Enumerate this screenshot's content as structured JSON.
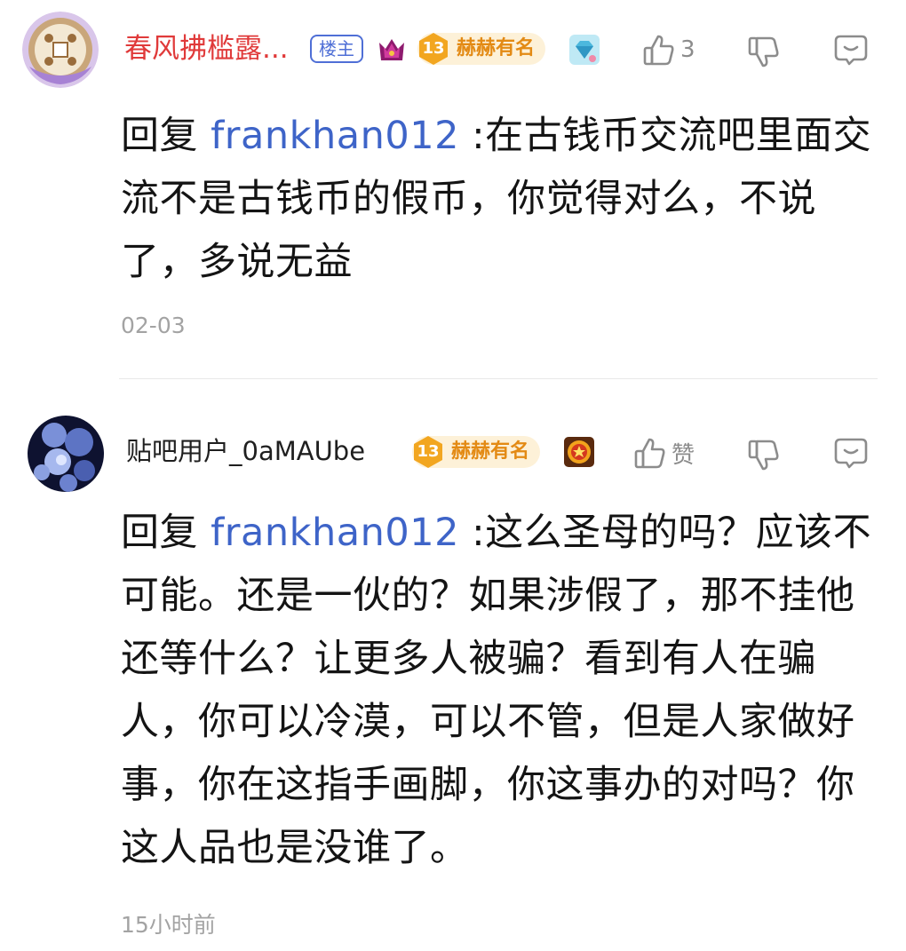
{
  "comments": [
    {
      "username": "春风拂槛露...",
      "op_badge": "楼主",
      "level": "13",
      "level_title": "赫赫有名",
      "like_label": "3",
      "reply_prefix": "回复",
      "mention": "frankhan012",
      "text": ":在古钱币交流吧里面交流不是古钱币的假币，你觉得对么，不说了，多说无益",
      "time": "02-03",
      "icons": [
        "avatar",
        "crown-badge-icon",
        "level-badge-icon",
        "diamond-badge-icon",
        "thumbs-up-icon",
        "thumbs-down-icon",
        "reply-icon"
      ]
    },
    {
      "username": "贴吧用户_0aMAUbe",
      "level": "13",
      "level_title": "赫赫有名",
      "like_label": "赞",
      "reply_prefix": "回复",
      "mention": "frankhan012",
      "text": ":这么圣母的吗？应该不可能。还是一伙的？如果涉假了，那不挂他还等什么？让更多人被骗？看到有人在骗人，你可以冷漠，可以不管，但是人家做好事，你在这指手画脚，你这事办的对吗？你这人品也是没谁了。",
      "time": "15小时前",
      "icons": [
        "avatar",
        "level-badge-icon",
        "medal-badge-icon",
        "thumbs-up-icon",
        "thumbs-down-icon",
        "reply-icon"
      ]
    }
  ],
  "colors": {
    "op_name": "#e03a3a",
    "mention": "#3e64c8",
    "op_badge": "#4f6fd6",
    "level_text": "#e38a14",
    "level_bg": "#fdf1d8",
    "muted": "#a3a3a3"
  }
}
